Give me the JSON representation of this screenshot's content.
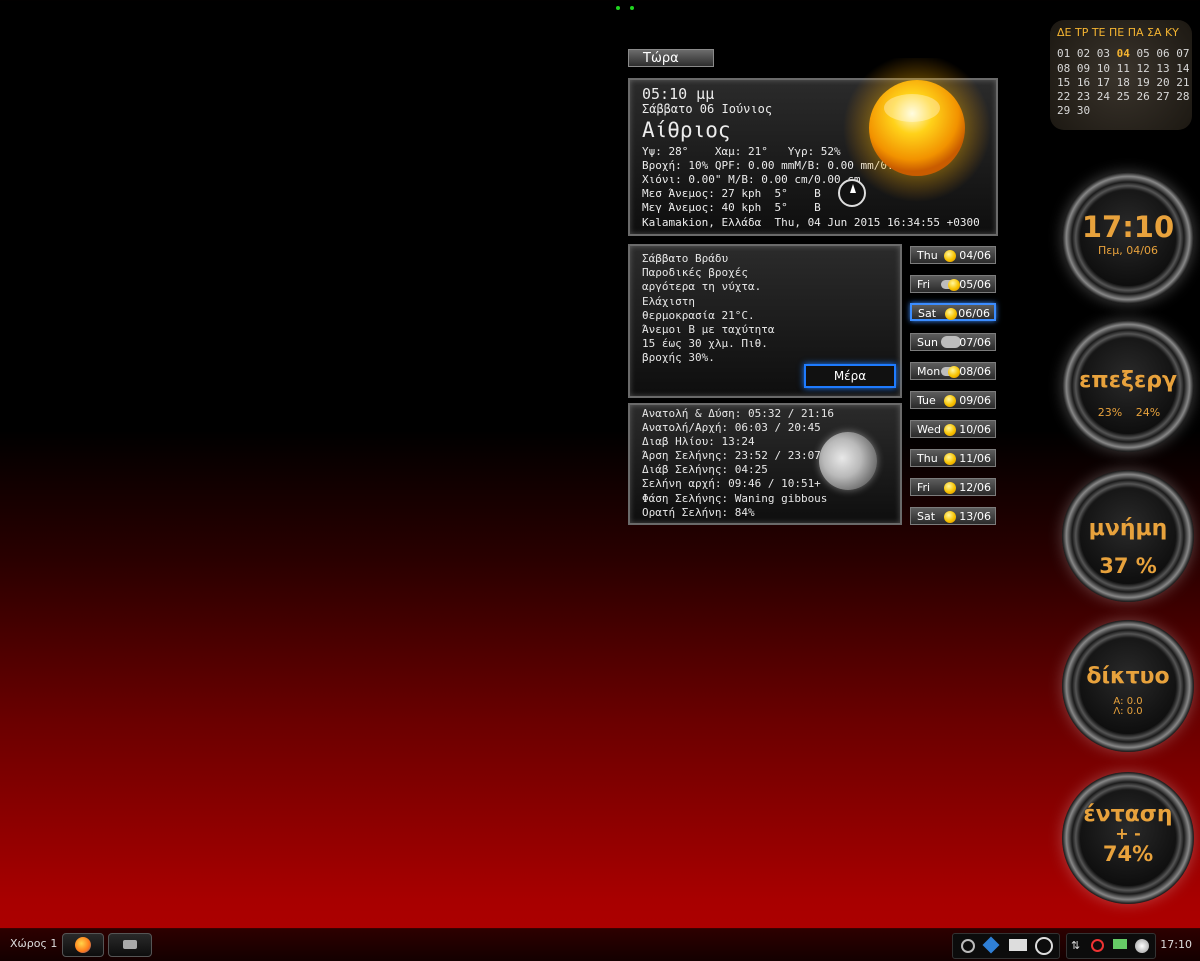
{
  "now_label": "Τώρα",
  "current": {
    "time": "05:10 μμ",
    "date": "Σάββατο 06 Ιούνιος",
    "condition": "Αίθριος",
    "line1": "Υψ: 28°    Χαμ: 21°   Υγρ: 52%",
    "line2": "Βροχή: 10% QPF: 0.00 mmM/B: 0.00 mm/0.00 mm",
    "line3": "Χιόνι: 0.00\" M/B: 0.00 cm/0.00 cm",
    "line4": "Μεσ Άνεμος: 27 kph  5°    Β",
    "line5": "Μεγ Άνεμος: 40 kph  5°    Β",
    "location": "Kalamakion, Ελλάδα  Thu, 04 Jun 2015 16:34:55 +0300"
  },
  "forecast": {
    "text": "Σάββατο Βράδυ\nΠαροδικές βροχές\nαργότερα τη νύχτα.\nΕλάχιστη\nθερμοκρασία 21°C.\nΆνεμοι Β με ταχύτητα\n15 έως 30 χλμ. Πιθ.\nβροχής 30%.",
    "button": "Μέρα"
  },
  "astro": {
    "text": "Ανατολή & Δύση: 05:32 / 21:16\nΑνατολή/Αρχή: 06:03 / 20:45\nΔιαβ Ηλίου: 13:24\nΆρση Σελήνης: 23:52 / 23:07-\nΔιάβ Σελήνης: 04:25\nΣελήνη αρχή: 09:46 / 10:51+\nΦάση Σελήνης: Waning gibbous\nΟρατή Σελήνη: 84%"
  },
  "days": [
    {
      "name": "Thu",
      "date": "04/06",
      "icon": "sun-icon"
    },
    {
      "name": "Fri",
      "date": "05/06",
      "icon": "sun-cloud-icon"
    },
    {
      "name": "Sat",
      "date": "06/06",
      "icon": "sun-icon",
      "selected": true
    },
    {
      "name": "Sun",
      "date": "07/06",
      "icon": "cloud-icon"
    },
    {
      "name": "Mon",
      "date": "08/06",
      "icon": "sun-cloud-icon"
    },
    {
      "name": "Tue",
      "date": "09/06",
      "icon": "sun-icon"
    },
    {
      "name": "Wed",
      "date": "10/06",
      "icon": "sun-icon"
    },
    {
      "name": "Thu",
      "date": "11/06",
      "icon": "sun-icon"
    },
    {
      "name": "Fri",
      "date": "12/06",
      "icon": "sun-icon"
    },
    {
      "name": "Sat",
      "date": "13/06",
      "icon": "sun-icon"
    }
  ],
  "calendar": {
    "header": "ΔΕ ΤΡ ΤΕ ΠΕ ΠΑ ΣΑ ΚΥ",
    "rows": [
      "01 02 03 04 05 06 07",
      "08 09 10 11 12 13 14",
      "15 16 17 18 19 20 21",
      "22 23 24 25 26 27 28",
      "29 30"
    ],
    "today": "04",
    "accent": "#f4b431"
  },
  "gauges": {
    "clock_time": "17:10",
    "clock_date": "Πεμ, 04/06",
    "cpu_label": "επεξεργ",
    "cpu1": "23%",
    "cpu2": "24%",
    "mem_label": "μνήμη",
    "mem_value": "37 %",
    "mem_fraction": 0.37,
    "net_label": "δίκτυο",
    "net_down": "Α: 0.0",
    "net_up": "Λ: 0.0",
    "vol_label": "ένταση",
    "vol_controls": "+ -",
    "vol_value": "74%",
    "vol_fraction": 0.74
  },
  "taskbar": {
    "workspace": "Χώρος 1",
    "clock": "17:10",
    "apps": [
      "firefox-icon",
      "app-launcher-icon"
    ],
    "tray": [
      "search-icon",
      "kodi-icon",
      "monitor-icon",
      "power-icon",
      "network-icon",
      "alarm-icon",
      "display-icon",
      "volume-icon"
    ]
  },
  "colors": {
    "accent": "#e8a23c",
    "selection": "#3b8cff"
  }
}
